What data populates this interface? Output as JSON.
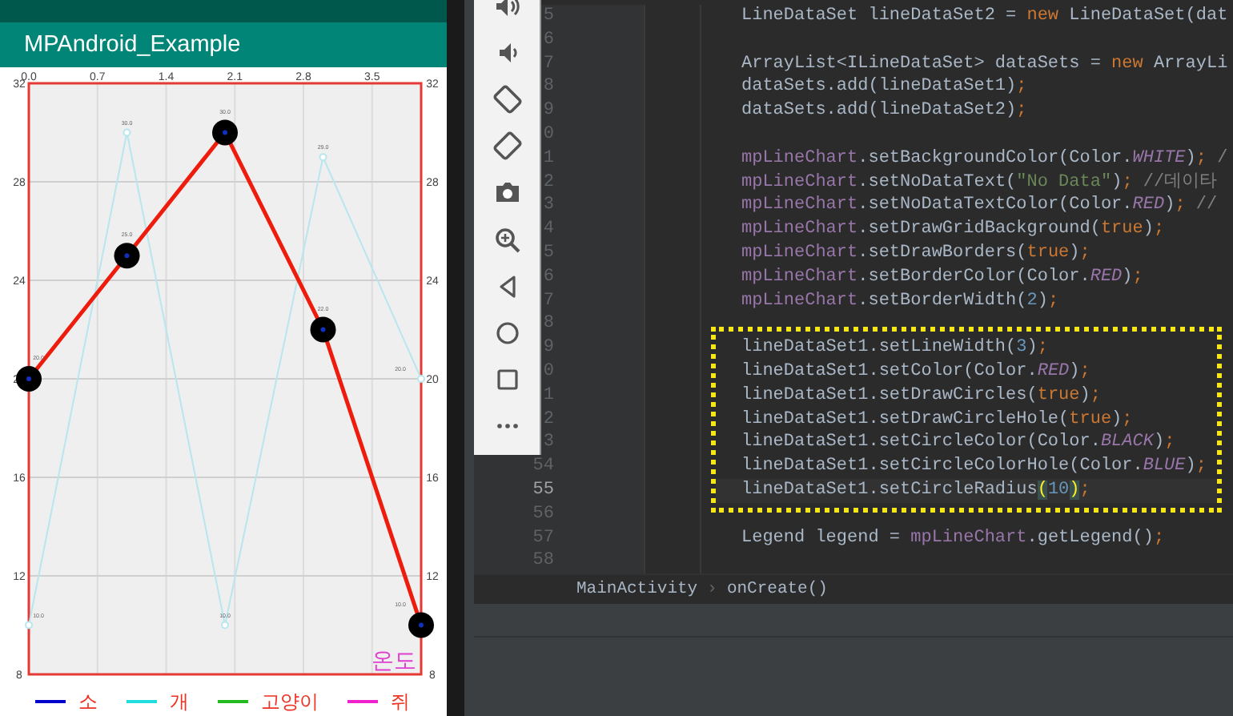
{
  "phone": {
    "app_title": "MPAndroid_Example",
    "chart": {
      "description": "온도",
      "right_axis_ticks": [
        "32",
        "28",
        "24",
        "20",
        "16",
        "12",
        "8"
      ],
      "chart_data": {
        "type": "line",
        "x": [
          0,
          1,
          2,
          3,
          4
        ],
        "xlim": [
          0,
          4
        ],
        "ylim": [
          8,
          32
        ],
        "xticks": [
          {
            "value": 0,
            "label": "0.0"
          },
          {
            "value": 0.7,
            "label": "0.7"
          },
          {
            "value": 1.4,
            "label": "1.4"
          },
          {
            "value": 2.1,
            "label": "2.1"
          },
          {
            "value": 2.8,
            "label": "2.8"
          },
          {
            "value": 3.5,
            "label": "3.5"
          }
        ],
        "yticks": [
          8,
          12,
          16,
          20,
          24,
          28,
          32
        ],
        "series": [
          {
            "color": "#b8e6ee",
            "values": [
              10,
              30,
              10,
              29,
              20
            ],
            "marker": "circle"
          },
          {
            "color": "#ee1c0c",
            "values": [
              20,
              25,
              30,
              22,
              10
            ],
            "marker": "circle"
          }
        ],
        "value_labels": [
          [
            "10.0",
            "30.0",
            "10.0",
            "29.0",
            "20.0"
          ],
          [
            "20.0",
            "25.0",
            "30.0",
            "22.0",
            "10.0"
          ]
        ],
        "grid": true
      },
      "legend": [
        {
          "label": "소",
          "color": "#0000cc"
        },
        {
          "label": "개",
          "color": "#22dddd"
        },
        {
          "label": "고양이",
          "color": "#22bb22"
        },
        {
          "label": "쥐",
          "color": "#ee22cc"
        }
      ]
    }
  },
  "emulator_toolbar": [
    {
      "kind": "volume-up"
    },
    {
      "kind": "volume-down"
    },
    {
      "kind": "rotate-left"
    },
    {
      "kind": "rotate-right"
    },
    {
      "kind": "camera"
    },
    {
      "kind": "zoom"
    },
    {
      "kind": "back"
    },
    {
      "kind": "home"
    },
    {
      "kind": "overview"
    },
    {
      "kind": "more"
    }
  ],
  "editor": {
    "lines": [
      {
        "number": "5",
        "tokens": [
          {
            "kind": "plain",
            "text": "LineDataSet lineDataSet2 = "
          },
          {
            "kind": "keyword",
            "text": "new"
          },
          {
            "kind": "plain",
            "text": " LineDataSet(dat"
          }
        ]
      },
      {
        "number": "6"
      },
      {
        "number": "7",
        "tokens": [
          {
            "kind": "plain",
            "text": "ArrayList<ILineDataSet> dataSets = "
          },
          {
            "kind": "keyword",
            "text": "new"
          },
          {
            "kind": "plain",
            "text": " ArrayLi"
          }
        ]
      },
      {
        "number": "8",
        "tokens": [
          {
            "kind": "plain",
            "text": "dataSets.add(lineDataSet1)"
          },
          {
            "kind": "keyword",
            "text": ";"
          }
        ]
      },
      {
        "number": "9",
        "tokens": [
          {
            "kind": "plain",
            "text": "dataSets.add(lineDataSet2)"
          },
          {
            "kind": "keyword",
            "text": ";"
          }
        ]
      },
      {
        "number": "0"
      },
      {
        "number": "1",
        "tokens": [
          {
            "kind": "member",
            "text": "mpLineChart"
          },
          {
            "kind": "plain",
            "text": ".setBackgroundColor(Color."
          },
          {
            "kind": "constant",
            "text": "WHITE"
          },
          {
            "kind": "plain",
            "text": ")"
          },
          {
            "kind": "keyword",
            "text": ";"
          },
          {
            "kind": "comment",
            "text": " /"
          }
        ]
      },
      {
        "number": "2",
        "tokens": [
          {
            "kind": "member",
            "text": "mpLineChart"
          },
          {
            "kind": "plain",
            "text": ".setNoDataText("
          },
          {
            "kind": "string",
            "text": "\"No Data\""
          },
          {
            "kind": "plain",
            "text": ")"
          },
          {
            "kind": "keyword",
            "text": ";"
          },
          {
            "kind": "comment",
            "text": " //데이타"
          }
        ]
      },
      {
        "number": "3",
        "tokens": [
          {
            "kind": "member",
            "text": "mpLineChart"
          },
          {
            "kind": "plain",
            "text": ".setNoDataTextColor(Color."
          },
          {
            "kind": "constant",
            "text": "RED"
          },
          {
            "kind": "plain",
            "text": ")"
          },
          {
            "kind": "keyword",
            "text": ";"
          },
          {
            "kind": "comment",
            "text": " //"
          }
        ]
      },
      {
        "number": "4",
        "tokens": [
          {
            "kind": "member",
            "text": "mpLineChart"
          },
          {
            "kind": "plain",
            "text": ".setDrawGridBackground("
          },
          {
            "kind": "keyword",
            "text": "true"
          },
          {
            "kind": "plain",
            "text": ")"
          },
          {
            "kind": "keyword",
            "text": ";"
          }
        ]
      },
      {
        "number": "5",
        "tokens": [
          {
            "kind": "member",
            "text": "mpLineChart"
          },
          {
            "kind": "plain",
            "text": ".setDrawBorders("
          },
          {
            "kind": "keyword",
            "text": "true"
          },
          {
            "kind": "plain",
            "text": ")"
          },
          {
            "kind": "keyword",
            "text": ";"
          }
        ]
      },
      {
        "number": "6",
        "tokens": [
          {
            "kind": "member",
            "text": "mpLineChart"
          },
          {
            "kind": "plain",
            "text": ".setBorderColor(Color."
          },
          {
            "kind": "constant",
            "text": "RED"
          },
          {
            "kind": "plain",
            "text": ")"
          },
          {
            "kind": "keyword",
            "text": ";"
          }
        ]
      },
      {
        "number": "7",
        "tokens": [
          {
            "kind": "member",
            "text": "mpLineChart"
          },
          {
            "kind": "plain",
            "text": ".setBorderWidth("
          },
          {
            "kind": "number",
            "text": "2"
          },
          {
            "kind": "plain",
            "text": ")"
          },
          {
            "kind": "keyword",
            "text": ";"
          }
        ]
      },
      {
        "number": "8"
      },
      {
        "number": "9",
        "highlighted": true,
        "tokens": [
          {
            "kind": "plain",
            "text": "lineDataSet1.setLineWidth("
          },
          {
            "kind": "number",
            "text": "3"
          },
          {
            "kind": "plain",
            "text": ")"
          },
          {
            "kind": "keyword",
            "text": ";"
          }
        ]
      },
      {
        "number": "0",
        "highlighted": true,
        "tokens": [
          {
            "kind": "plain",
            "text": "lineDataSet1.setColor(Color."
          },
          {
            "kind": "constant",
            "text": "RED"
          },
          {
            "kind": "plain",
            "text": ")"
          },
          {
            "kind": "keyword",
            "text": ";"
          }
        ]
      },
      {
        "number": "1",
        "highlighted": true,
        "tokens": [
          {
            "kind": "plain",
            "text": "lineDataSet1.setDrawCircles("
          },
          {
            "kind": "keyword",
            "text": "true"
          },
          {
            "kind": "plain",
            "text": ")"
          },
          {
            "kind": "keyword",
            "text": ";"
          }
        ]
      },
      {
        "number": "2",
        "highlighted": true,
        "tokens": [
          {
            "kind": "plain",
            "text": "lineDataSet1.setDrawCircleHole("
          },
          {
            "kind": "keyword",
            "text": "true"
          },
          {
            "kind": "plain",
            "text": ")"
          },
          {
            "kind": "keyword",
            "text": ";"
          }
        ]
      },
      {
        "number": "3",
        "highlighted": true,
        "tokens": [
          {
            "kind": "plain",
            "text": "lineDataSet1.setCircleColor(Color."
          },
          {
            "kind": "constant",
            "text": "BLACK"
          },
          {
            "kind": "plain",
            "text": ")"
          },
          {
            "kind": "keyword",
            "text": ";"
          }
        ]
      },
      {
        "number": "54",
        "highlighted": true,
        "tokens": [
          {
            "kind": "plain",
            "text": "lineDataSet1.setCircleColorHole(Color."
          },
          {
            "kind": "constant",
            "text": "BLUE"
          },
          {
            "kind": "plain",
            "text": ")"
          },
          {
            "kind": "keyword",
            "text": ";"
          }
        ]
      },
      {
        "number": "55",
        "highlighted": true,
        "current": true,
        "tokens": [
          {
            "kind": "plain",
            "text": "lineDataSet1.setCircleRadius"
          },
          {
            "kind": "brace",
            "text": "("
          },
          {
            "kind": "number",
            "text": "10"
          },
          {
            "kind": "brace",
            "text": ")"
          },
          {
            "kind": "keyword",
            "text": ";"
          }
        ]
      },
      {
        "number": "56"
      },
      {
        "number": "57",
        "tokens": [
          {
            "kind": "plain",
            "text": "Legend legend = "
          },
          {
            "kind": "member",
            "text": "mpLineChart"
          },
          {
            "kind": "plain",
            "text": ".getLegend()"
          },
          {
            "kind": "keyword",
            "text": ";"
          }
        ]
      },
      {
        "number": "58"
      }
    ],
    "breadcrumbs": [
      "MainActivity",
      "onCreate()"
    ],
    "breadcrumb_separator": "›"
  }
}
